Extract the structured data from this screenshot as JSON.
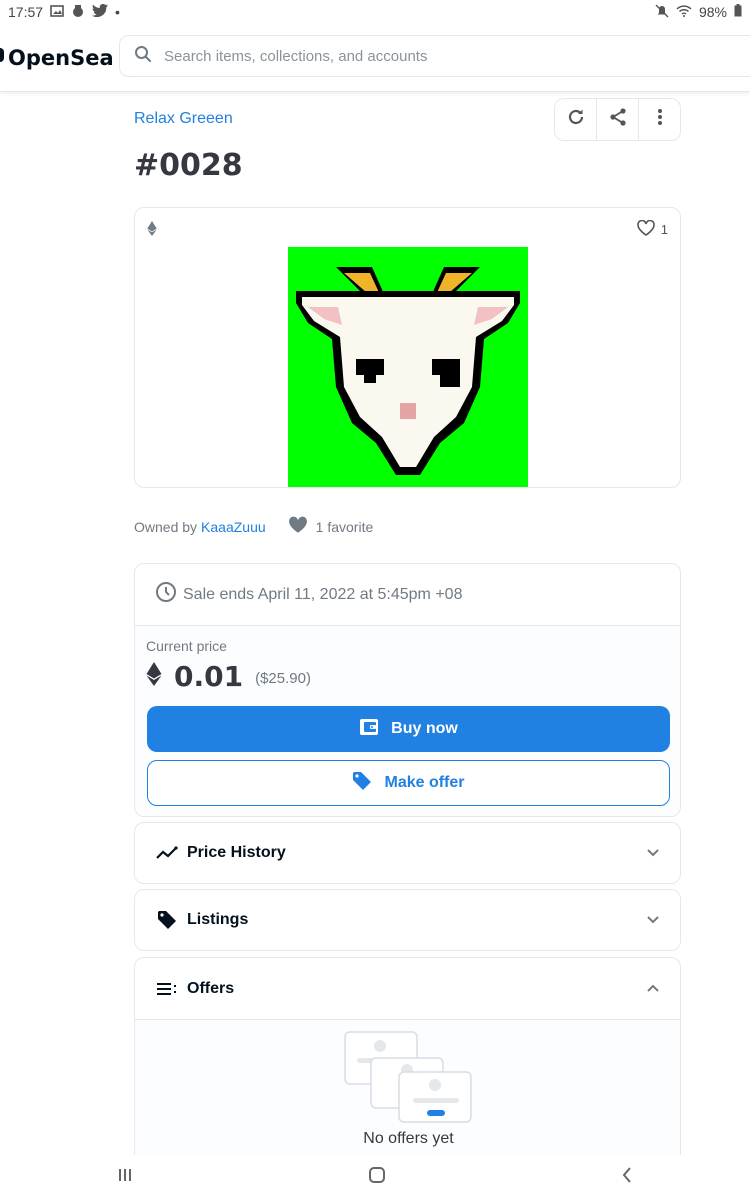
{
  "status_bar": {
    "time": "17:57",
    "dot": "•",
    "battery": "98%"
  },
  "header": {
    "logo": "OpenSea",
    "search_placeholder": "Search items, collections, and accounts"
  },
  "item": {
    "collection": "Relax Greeen",
    "title": "#0028",
    "like_count": "1"
  },
  "ownership": {
    "owned_by_label": "Owned by",
    "owner": "KaaaZuuu",
    "favorites": "1 favorite"
  },
  "sale": {
    "ends": "Sale ends April 11, 2022 at 5:45pm +08",
    "current_price_label": "Current price",
    "price": "0.01",
    "usd": "($25.90)",
    "buy_label": "Buy now",
    "offer_label": "Make offer"
  },
  "panels": {
    "price_history": "Price History",
    "listings": "Listings",
    "offers": "Offers",
    "no_offers": "No offers yet"
  },
  "colors": {
    "accent": "#2081e2",
    "goat_bg": "#00ff00"
  },
  "icons": [
    "search-icon",
    "refresh-icon",
    "share-icon",
    "more-icon",
    "ethereum-icon",
    "heart-icon",
    "clock-icon",
    "wallet-icon",
    "tag-icon",
    "chart-line-icon",
    "offers-list-icon",
    "chevron-down-icon",
    "chevron-up-icon"
  ]
}
